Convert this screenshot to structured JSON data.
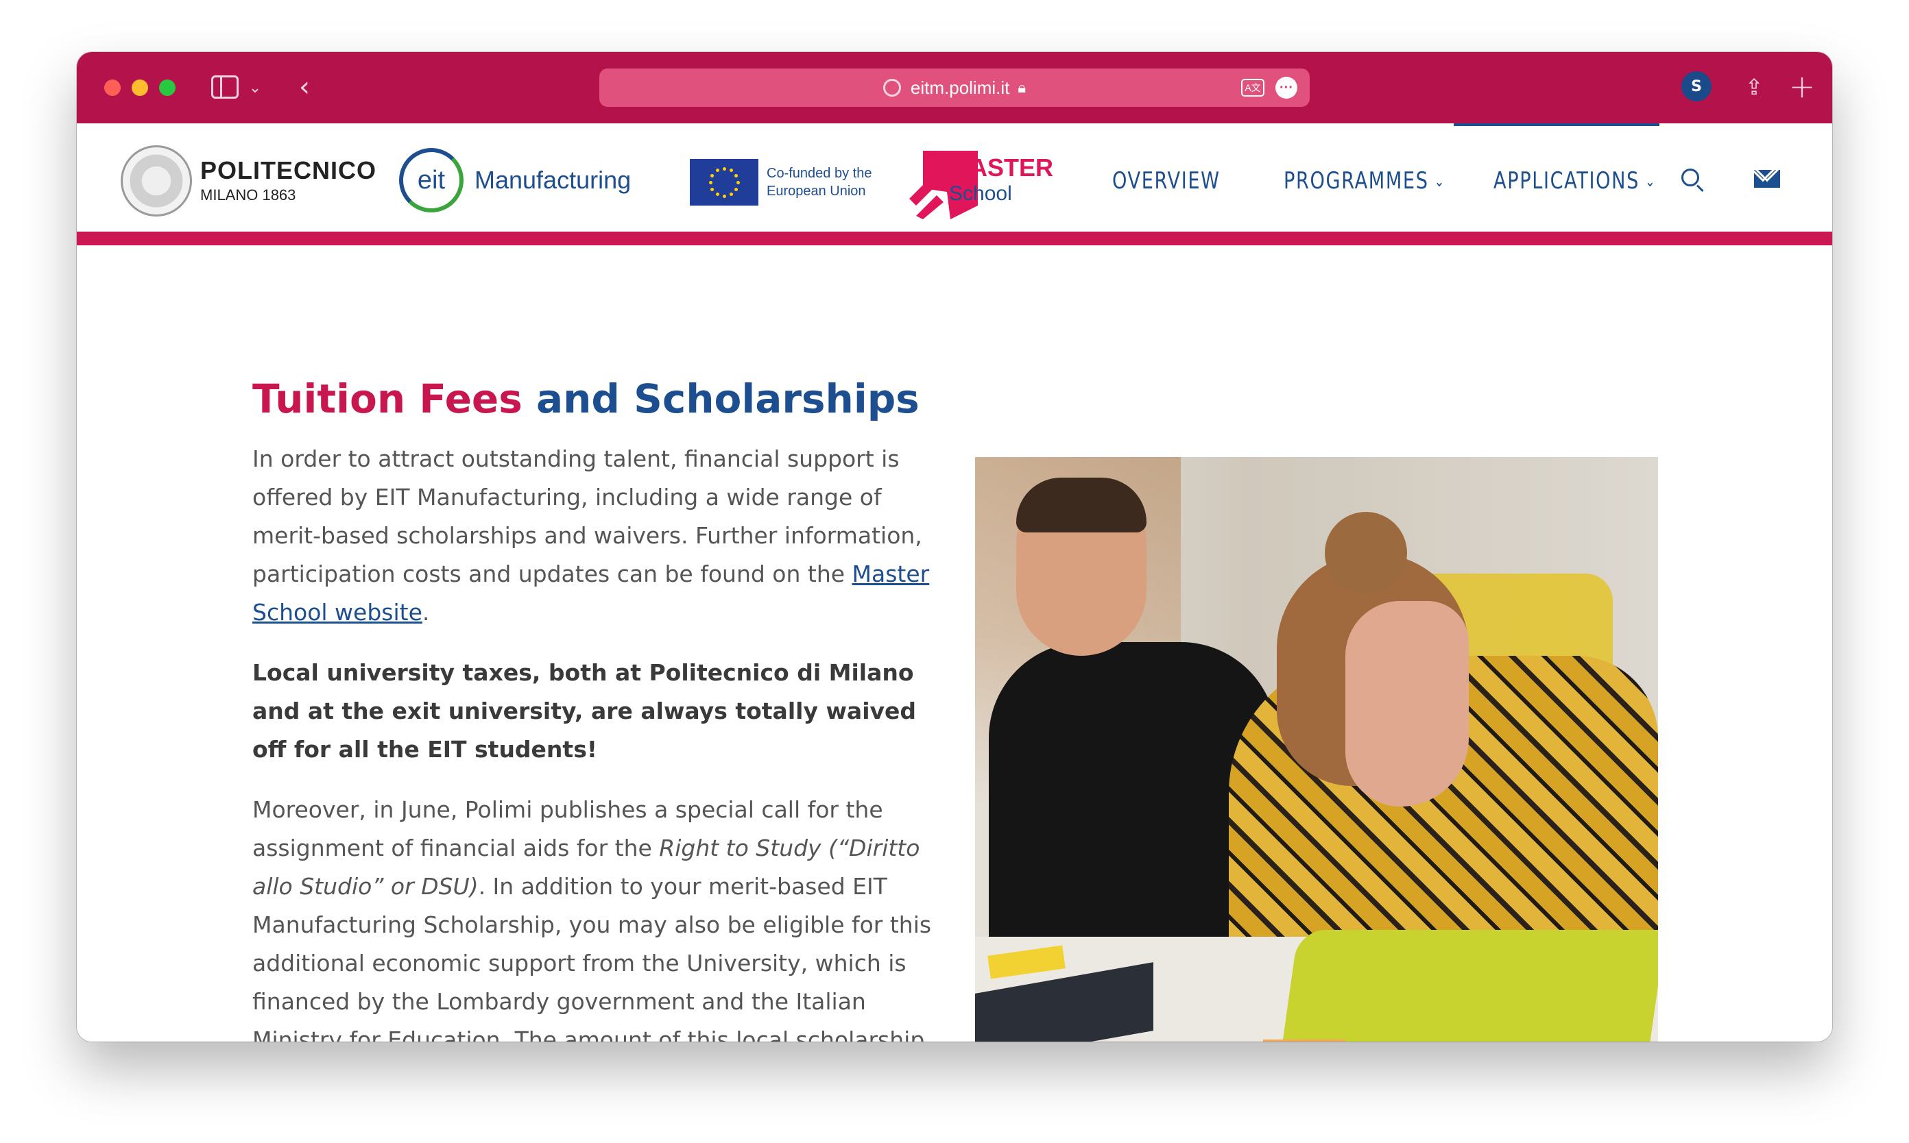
{
  "browser": {
    "url": "eitm.polimi.it"
  },
  "header": {
    "polimi": {
      "line1": "POLITECNICO",
      "line2": "MILANO 1863"
    },
    "eit": {
      "mark": "eit",
      "word": "Manufacturing"
    },
    "eu": {
      "line1": "Co-funded by the",
      "line2": "European Union"
    },
    "master_school": {
      "line1": "MASTER",
      "line2": "School"
    },
    "nav": [
      {
        "label": "OVERVIEW"
      },
      {
        "label": "PROGRAMMES"
      },
      {
        "label": "APPLICATIONS"
      }
    ]
  },
  "content": {
    "title_part1": "Tuition Fees",
    "title_part2": "and Scholarships",
    "p1_before_link": "In order to attract outstanding talent, financial support is offered by EIT Manufacturing, including a wide range of merit-based scholarships and waivers. Further information, participation costs and updates can be found on the ",
    "p1_link": "Master School website",
    "p1_after_link": ".",
    "p2_bold": "Local university taxes, both at Politecnico di Milano and at the exit university, are always totally waived off for all the EIT students!",
    "p3_before_italic": "Moreover, in June, Polimi publishes a special call for the assignment of financial aids for the ",
    "p3_italic": "Right to Study (“Diritto allo Studio” or DSU)",
    "p3_after_italic": ". In addition to your merit-based EIT Manufacturing Scholarship, you may also be eligible for this additional economic support from the University, which is financed by the Lombardy government and the Italian Ministry for Education. The amount of this local scholarship varies depending on the economic conditions."
  },
  "colors": {
    "titlebar": "#b3124a",
    "accent_magenta": "#cb1853",
    "brand_blue": "#1d4e8f"
  }
}
